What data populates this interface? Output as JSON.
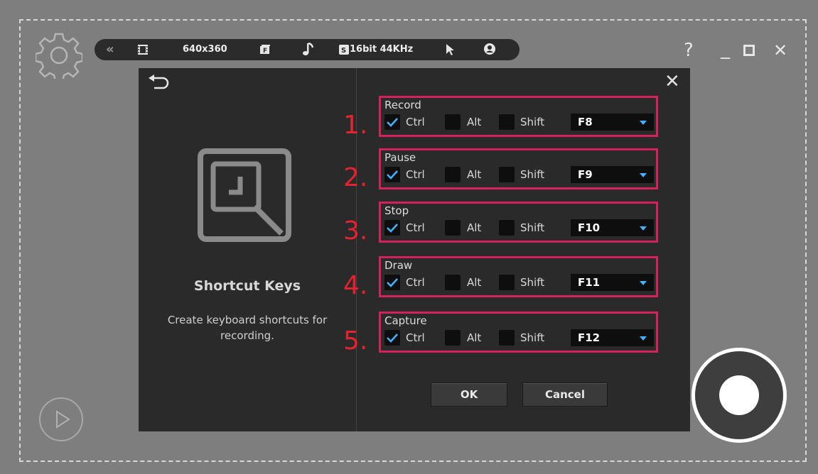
{
  "toolbar": {
    "resolution": "640x360",
    "audio": "16bit 44KHz",
    "icons": [
      "collapse-icon",
      "film-icon",
      "fullscreen-icon",
      "music-note-icon",
      "sound-icon",
      "cursor-icon",
      "webcam-icon"
    ]
  },
  "window_controls": {
    "help": "?",
    "minimize": "_",
    "maximize": "□",
    "close": "✕"
  },
  "dialog": {
    "title": "Shortcut Keys",
    "description": "Create keyboard shortcuts for recording.",
    "ok_label": "OK",
    "cancel_label": "Cancel",
    "close_label": "✕"
  },
  "modifiers": {
    "ctrl": "Ctrl",
    "alt": "Alt",
    "shift": "Shift"
  },
  "shortcuts": [
    {
      "number": "1.",
      "name": "Record",
      "ctrl": true,
      "alt": false,
      "shift": false,
      "key": "F8"
    },
    {
      "number": "2.",
      "name": "Pause",
      "ctrl": true,
      "alt": false,
      "shift": false,
      "key": "F9"
    },
    {
      "number": "3.",
      "name": "Stop",
      "ctrl": true,
      "alt": false,
      "shift": false,
      "key": "F10"
    },
    {
      "number": "4.",
      "name": "Draw",
      "ctrl": true,
      "alt": false,
      "shift": false,
      "key": "F11"
    },
    {
      "number": "5.",
      "name": "Capture",
      "ctrl": true,
      "alt": false,
      "shift": false,
      "key": "F12"
    }
  ],
  "colors": {
    "highlight": "#d6225b",
    "number": "#e4232f",
    "check": "#3fb3ff"
  }
}
